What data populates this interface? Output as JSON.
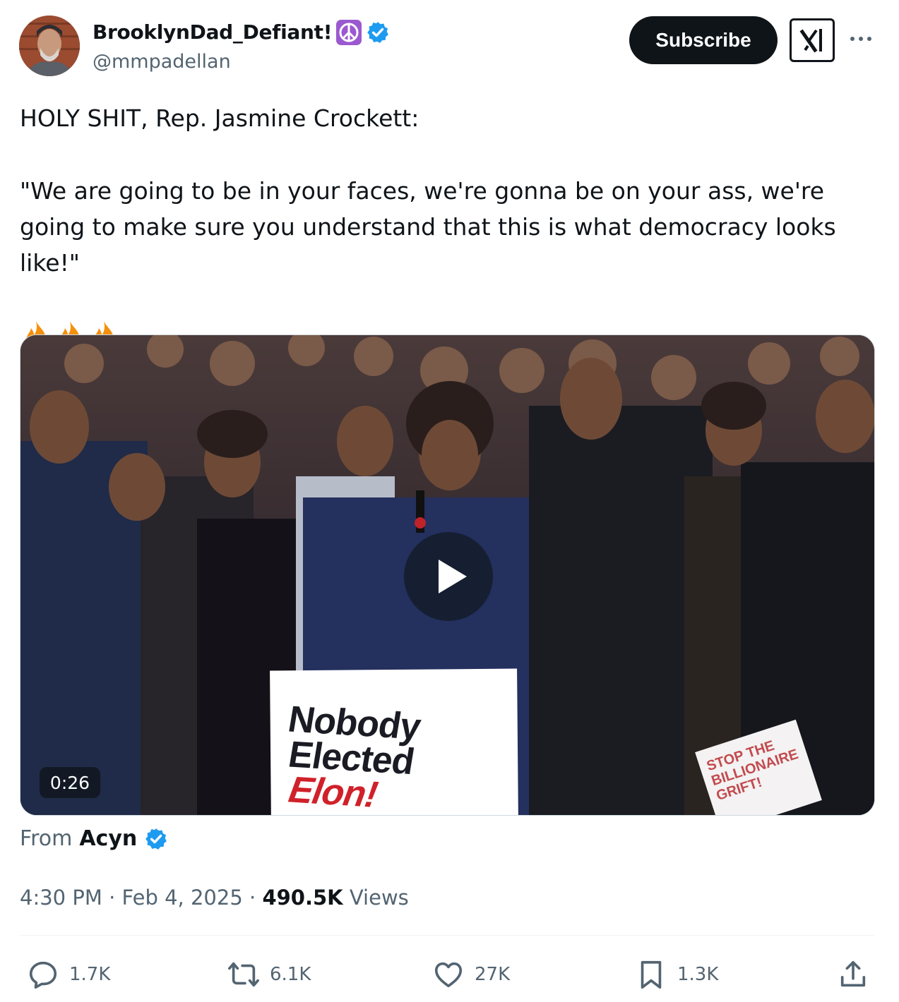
{
  "author": {
    "display_name": "BrooklynDad_Defiant!",
    "handle": "@mmpadellan",
    "verified": true,
    "name_emoji": "peace-symbol"
  },
  "header": {
    "subscribe_label": "Subscribe"
  },
  "tweet": {
    "line1": "HOLY SHIT, Rep. Jasmine Crockett:",
    "quote": "\"We are going to be in your faces, we're gonna be on your ass, we're going to make sure you understand that this is what democracy looks like!\"",
    "emojis": [
      "fire",
      "fire",
      "fire"
    ]
  },
  "media": {
    "duration": "0:26",
    "sign_lines": [
      "Nobody",
      "Elected",
      "Elon!"
    ],
    "sign2_lines": [
      "STOP THE",
      "BILLIONAIRE",
      "GRIFT!"
    ]
  },
  "source": {
    "prefix": "From",
    "name": "Acyn",
    "verified": true
  },
  "meta": {
    "time": "4:30 PM",
    "sep": "·",
    "date": "Feb 4, 2025",
    "views_count": "490.5K",
    "views_label": "Views"
  },
  "actions": {
    "replies": "1.7K",
    "reposts": "6.1K",
    "likes": "27K",
    "bookmarks": "1.3K"
  },
  "colors": {
    "verified_blue": "#1d9bf0",
    "text_primary": "#0f1419",
    "text_secondary": "#536471",
    "button_dark": "#0f1419",
    "sign_red": "#d0212a"
  }
}
